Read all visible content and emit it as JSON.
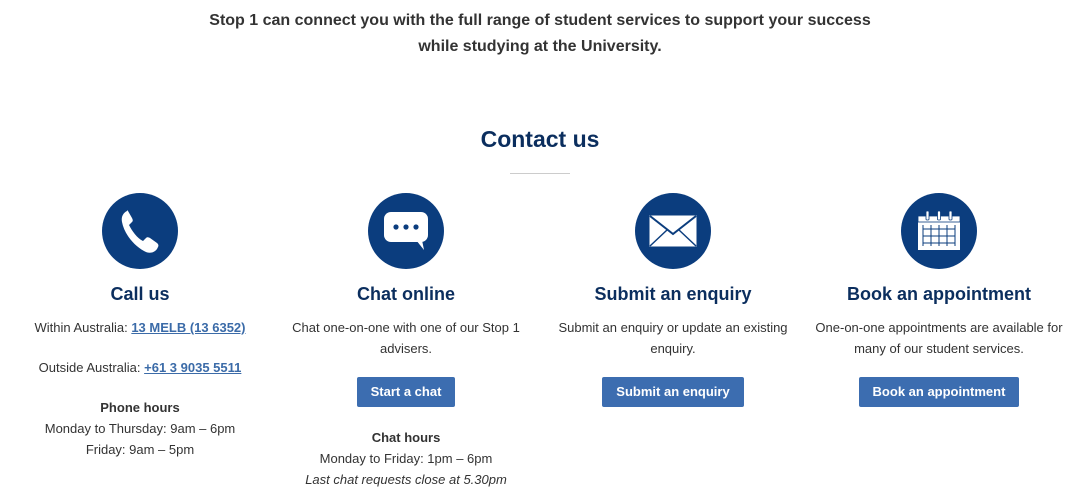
{
  "intro": {
    "line1": "Stop 1 can connect you with the full range of student services to support your success",
    "line2": "while studying at the University."
  },
  "section_title": "Contact us",
  "columns": {
    "call": {
      "icon": "phone-icon",
      "title": "Call us",
      "within_label": "Within Australia: ",
      "within_link": "13 MELB (13 6352)",
      "outside_label": "Outside Australia: ",
      "outside_link": "+61 3 9035 5511",
      "hours_heading": "Phone hours",
      "hours_line1": "Monday to Thursday: 9am – 6pm",
      "hours_line2": "Friday: 9am – 5pm"
    },
    "chat": {
      "icon": "chat-bubble-icon",
      "title": "Chat online",
      "description": "Chat one-on-one with one of our Stop 1 advisers.",
      "button": "Start a chat",
      "hours_heading": "Chat hours",
      "hours_line1": "Monday to Friday: 1pm – 6pm",
      "hours_note": "Last chat requests close at 5.30pm"
    },
    "enquiry": {
      "icon": "envelope-icon",
      "title": "Submit an enquiry",
      "description": "Submit an enquiry or update an existing enquiry.",
      "button": "Submit an enquiry"
    },
    "appointment": {
      "icon": "calendar-icon",
      "title": "Book an appointment",
      "description": "One-on-one appointments are available for many of our student services.",
      "button": "Book an appointment"
    }
  },
  "colors": {
    "icon_bg": "#0b3d7e",
    "heading": "#0b2e5e",
    "button_bg": "#3c6db0",
    "link": "#3b6ba8"
  }
}
